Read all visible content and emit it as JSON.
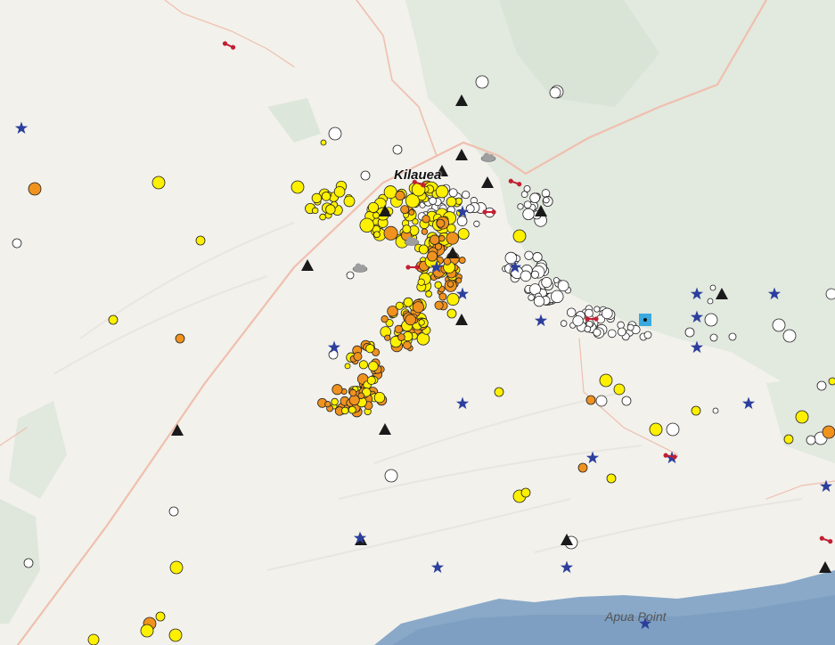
{
  "map": {
    "place_labels": {
      "kilauea": "Kilauea",
      "apua_point": "Apua Point"
    },
    "colors": {
      "land": "#f2f1ec",
      "vegetation": "#dfe7dd",
      "ocean": "#8aa9c8",
      "road": "#f0bfae",
      "quake_recent": "#fdf000",
      "quake_mid": "#f0921e",
      "quake_old": "#ffffff",
      "quake_stroke": "#222222",
      "seismometer": "#1a1a1a",
      "gps_station": "#2d3f9c",
      "webcam": "#c21f32",
      "gas_sensor": "#9e9e9e",
      "tiltmeter": "#39a9df"
    },
    "legend_types": [
      "earthquake-recent",
      "earthquake-intermediate",
      "earthquake-older",
      "seismometer-triangle",
      "gps-station-star",
      "webcam-marker",
      "gas-sensor-cloud",
      "tiltmeter-square"
    ]
  }
}
